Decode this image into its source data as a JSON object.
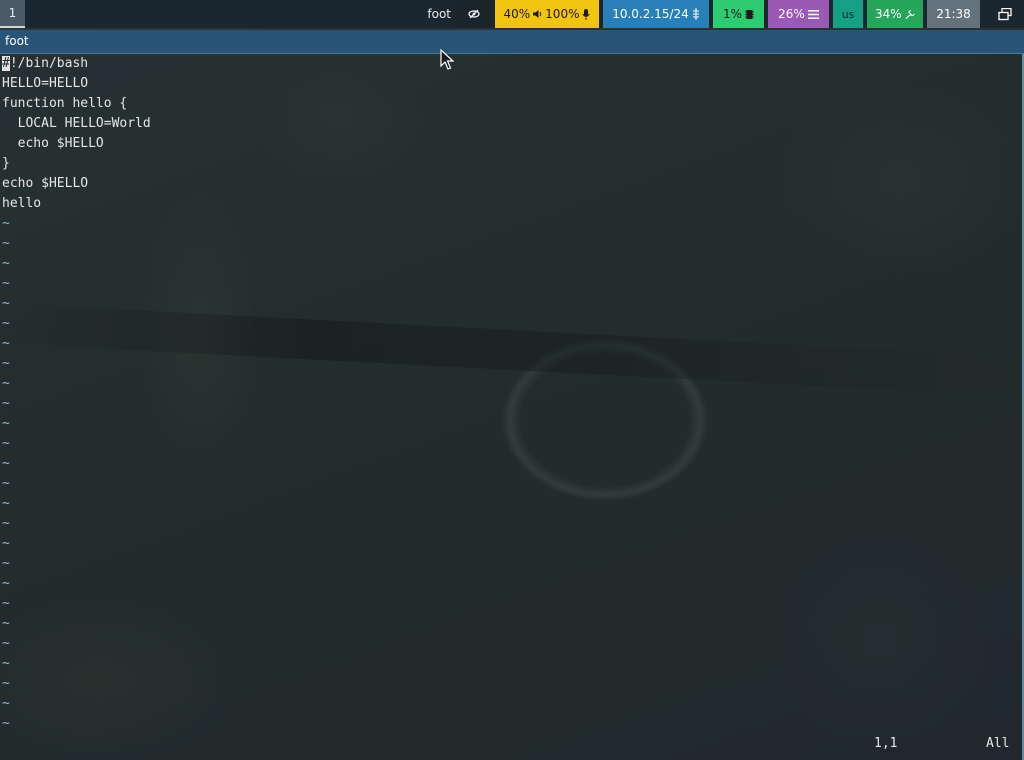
{
  "topbar": {
    "workspace": "1",
    "window_title": "foot",
    "idle_icon": "eye-slash-icon",
    "audio": {
      "volume": "40%",
      "mic": "100%",
      "volume_icon": "speaker-icon",
      "mic_icon": "microphone-icon"
    },
    "network": {
      "address": "10.0.2.15/24",
      "icon": "ethernet-icon"
    },
    "cpu": {
      "value": "1%",
      "icon": "chip-icon"
    },
    "memory": {
      "value": "26%",
      "icon": "menu-bars-icon"
    },
    "keyboard_layout": "us",
    "battery": {
      "value": "34%",
      "icon": "plug-icon"
    },
    "clock": "21:38",
    "tray_icon": "windows-icon",
    "colors": {
      "audio": "#f1c40f",
      "network": "#2980b9",
      "cpu": "#2ecc71",
      "memory": "#9b59b6",
      "layout": "#16a085",
      "battery": "#26a65b",
      "clock": "#64727d"
    }
  },
  "window": {
    "title": "foot",
    "title_color": "#285577"
  },
  "editor": {
    "cursor_char": "#",
    "lines": [
      "!/bin/bash",
      "HELLO=HELLO",
      "function hello {",
      "  LOCAL HELLO=World",
      "  echo $HELLO",
      "}",
      "echo $HELLO",
      "hello"
    ],
    "empty_line_marker": "~",
    "status": {
      "position": "1,1",
      "scroll": "All"
    }
  }
}
